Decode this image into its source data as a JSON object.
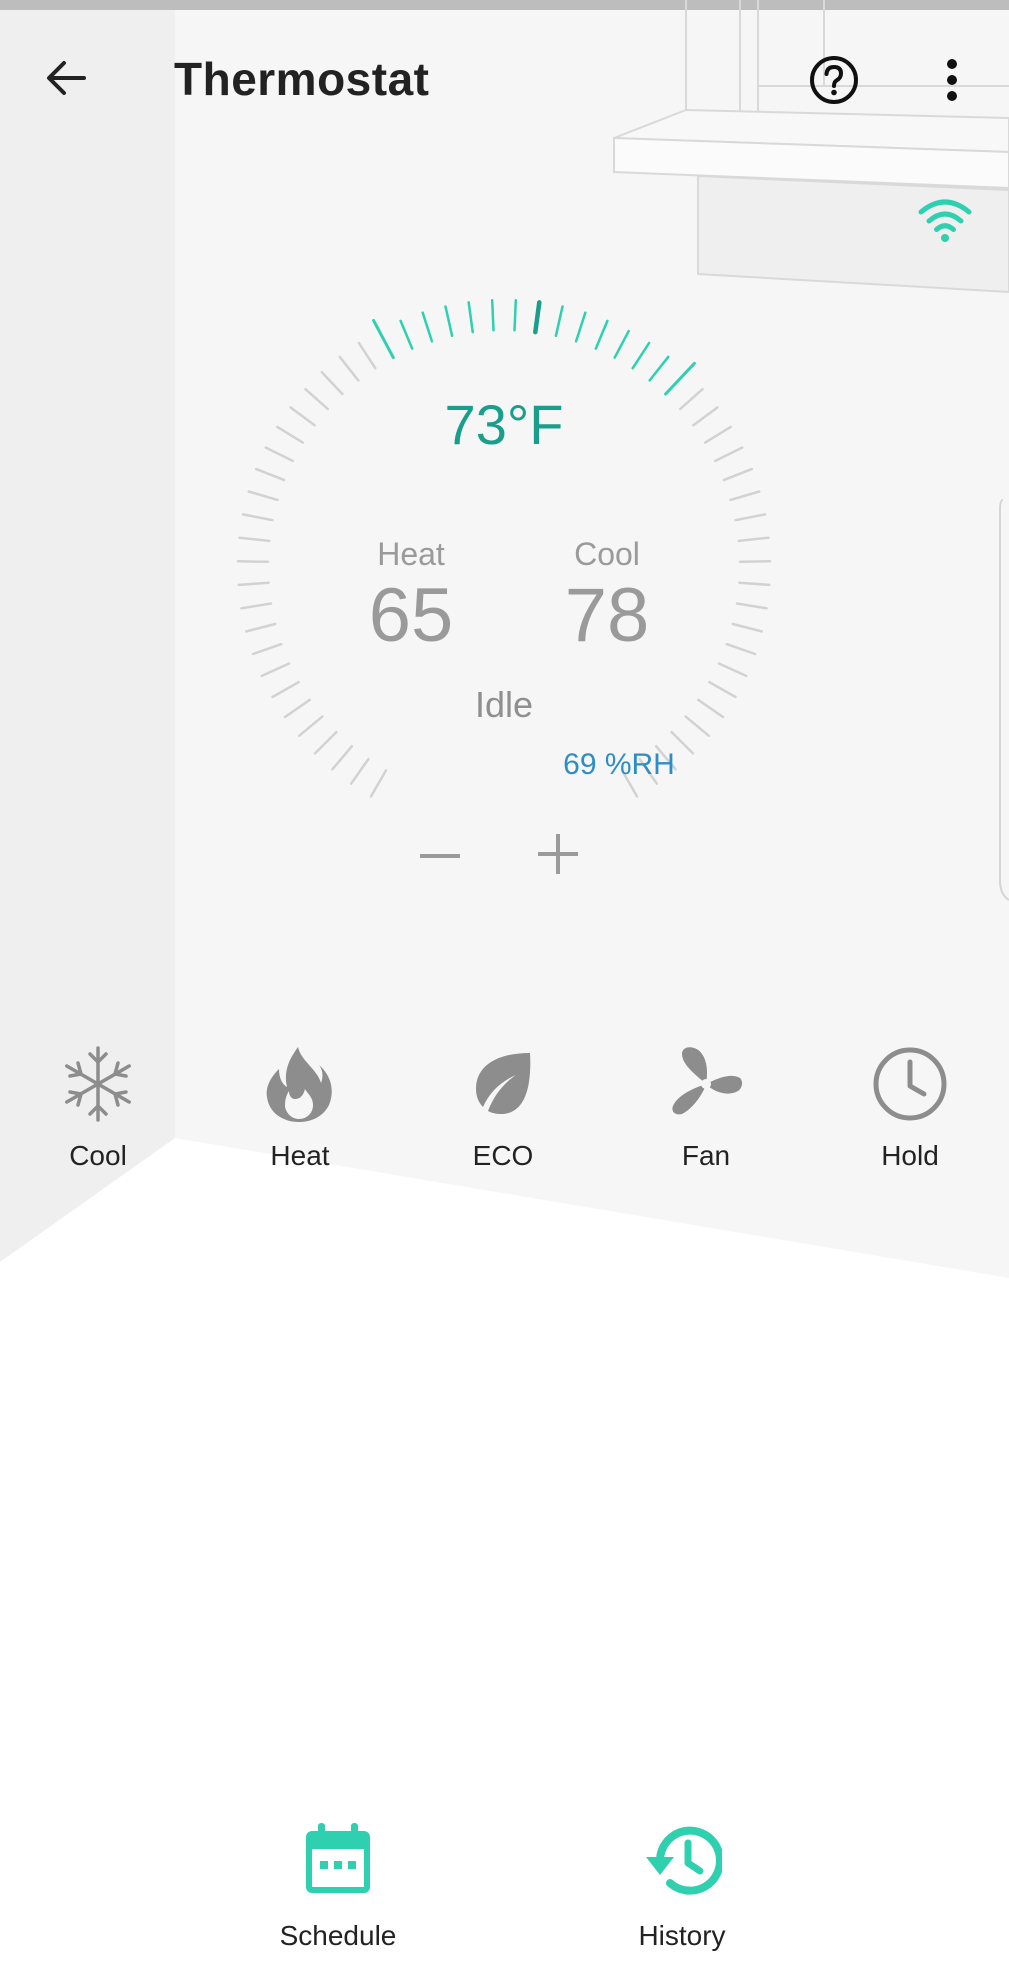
{
  "header": {
    "title": "Thermostat"
  },
  "icons": {
    "back": "arrow-left-icon",
    "help": "question-circle-icon",
    "more": "more-vertical-icon",
    "wifi": "wifi-icon"
  },
  "thermostat": {
    "current_temp": "73°F",
    "heat_label": "Heat",
    "heat_setpoint": "65",
    "cool_label": "Cool",
    "cool_setpoint": "78",
    "status": "Idle",
    "humidity": "69 %RH",
    "minus_label": "−",
    "plus_label": "+"
  },
  "modes": [
    {
      "label": "Cool",
      "icon": "snowflake-icon"
    },
    {
      "label": "Heat",
      "icon": "flame-icon"
    },
    {
      "label": "ECO",
      "icon": "leaf-icon"
    },
    {
      "label": "Fan",
      "icon": "fan-icon"
    },
    {
      "label": "Hold",
      "icon": "clock-icon"
    }
  ],
  "bottom_nav": [
    {
      "label": "Schedule",
      "icon": "calendar-icon"
    },
    {
      "label": "History",
      "icon": "history-icon"
    }
  ],
  "colors": {
    "accent": "#2fd0b0",
    "current_temp": "#199e8c",
    "humidity": "#2e8dc7",
    "inactive_icon": "#8d8d8d",
    "tick": "#d2d2d2"
  }
}
